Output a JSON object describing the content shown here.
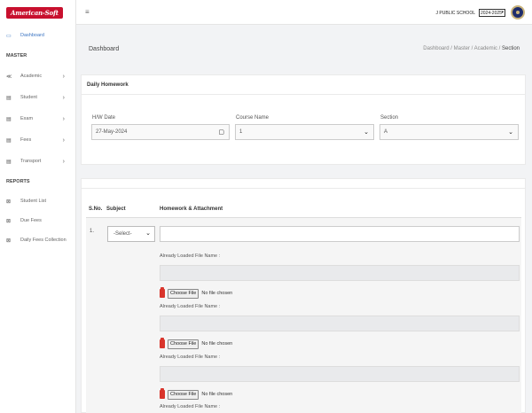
{
  "brand": {
    "logo_text": "American-Soft"
  },
  "topbar": {
    "menu_icon": "hamburger-icon",
    "school_name": "J PUBLIC SCHOOL",
    "session_value": "2024-2025"
  },
  "sidebar": {
    "items": [
      {
        "label": "Dashboard",
        "icon": "dashboard-icon",
        "active": true
      }
    ],
    "section_master": "MASTER",
    "master_items": [
      {
        "label": "Academic",
        "icon": "academic-icon"
      },
      {
        "label": "Student",
        "icon": "student-icon"
      },
      {
        "label": "Exam",
        "icon": "exam-icon"
      },
      {
        "label": "Fees",
        "icon": "fees-icon"
      },
      {
        "label": "Transport",
        "icon": "transport-icon"
      }
    ],
    "section_reports": "REPORTS",
    "report_items": [
      {
        "label": "Student List",
        "icon": "report-icon"
      },
      {
        "label": "Due Fees",
        "icon": "report-icon"
      },
      {
        "label": "Daily Fees Collection",
        "icon": "report-icon"
      }
    ]
  },
  "page": {
    "title": "Dashboard",
    "breadcrumb": [
      "Dashboard",
      "Master",
      "Academic",
      "Section"
    ]
  },
  "form": {
    "card_title": "Daily Homework",
    "hw_date_label": "H/W Date",
    "hw_date_value": "27-May-2024",
    "course_label": "Course Name",
    "course_value": "1",
    "section_label": "Section",
    "section_value": "A"
  },
  "table": {
    "headers": [
      "S.No.",
      "Subject",
      "Homework & Attachment"
    ],
    "row": {
      "sno": "1.",
      "subject_value": "-Select-",
      "attachment_label": "Already Loaded File Name :",
      "choose_file_label": "Choose File",
      "no_file_text": "No file chosen"
    }
  },
  "colors": {
    "accent": "#3a74c2",
    "logo_bg": "#c8102e",
    "pdf_red": "#d9352c"
  }
}
